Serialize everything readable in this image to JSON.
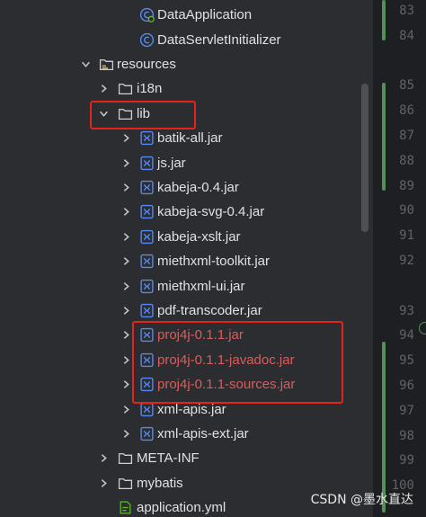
{
  "tree": {
    "items": [
      {
        "label": "DataApplication",
        "icon": "spring-class-icon",
        "chevron": "none",
        "indent": 3,
        "style": "normal"
      },
      {
        "label": "DataServletInitializer",
        "icon": "class-icon",
        "chevron": "none",
        "indent": 3,
        "style": "normal"
      },
      {
        "label": "resources",
        "icon": "resources-folder-icon",
        "chevron": "down",
        "indent": 1,
        "style": "normal"
      },
      {
        "label": "i18n",
        "icon": "folder-icon",
        "chevron": "right",
        "indent": 2,
        "style": "normal"
      },
      {
        "label": "lib",
        "icon": "folder-icon",
        "chevron": "down",
        "indent": 2,
        "style": "normal"
      },
      {
        "label": "batik-all.jar",
        "icon": "jar-icon",
        "chevron": "right",
        "indent": 3,
        "style": "normal"
      },
      {
        "label": "js.jar",
        "icon": "jar-icon",
        "chevron": "right",
        "indent": 3,
        "style": "normal"
      },
      {
        "label": "kabeja-0.4.jar",
        "icon": "jar-icon",
        "chevron": "right",
        "indent": 3,
        "style": "normal"
      },
      {
        "label": "kabeja-svg-0.4.jar",
        "icon": "jar-icon",
        "chevron": "right",
        "indent": 3,
        "style": "normal"
      },
      {
        "label": "kabeja-xslt.jar",
        "icon": "jar-icon",
        "chevron": "right",
        "indent": 3,
        "style": "normal"
      },
      {
        "label": "miethxml-toolkit.jar",
        "icon": "jar-icon",
        "chevron": "right",
        "indent": 3,
        "style": "normal"
      },
      {
        "label": "miethxml-ui.jar",
        "icon": "jar-icon",
        "chevron": "right",
        "indent": 3,
        "style": "normal"
      },
      {
        "label": "pdf-transcoder.jar",
        "icon": "jar-icon",
        "chevron": "right",
        "indent": 3,
        "style": "normal"
      },
      {
        "label": "proj4j-0.1.1.jar",
        "icon": "jar-icon",
        "chevron": "right",
        "indent": 3,
        "style": "red"
      },
      {
        "label": "proj4j-0.1.1-javadoc.jar",
        "icon": "jar-icon",
        "chevron": "right",
        "indent": 3,
        "style": "red"
      },
      {
        "label": "proj4j-0.1.1-sources.jar",
        "icon": "jar-icon",
        "chevron": "right",
        "indent": 3,
        "style": "red"
      },
      {
        "label": "xml-apis.jar",
        "icon": "jar-icon",
        "chevron": "right",
        "indent": 3,
        "style": "normal"
      },
      {
        "label": "xml-apis-ext.jar",
        "icon": "jar-icon",
        "chevron": "right",
        "indent": 3,
        "style": "normal"
      },
      {
        "label": "META-INF",
        "icon": "folder-icon",
        "chevron": "right",
        "indent": 2,
        "style": "normal"
      },
      {
        "label": "mybatis",
        "icon": "folder-icon",
        "chevron": "right",
        "indent": 2,
        "style": "normal"
      },
      {
        "label": "application.yml",
        "icon": "yaml-file-icon",
        "chevron": "none",
        "indent": 2,
        "style": "normal"
      }
    ]
  },
  "gutter": {
    "lines": [
      "83",
      "84",
      "",
      "85",
      "86",
      "87",
      "88",
      "89",
      "90",
      "91",
      "92",
      "",
      "93",
      "94",
      "95",
      "96",
      "97",
      "98",
      "99",
      "100"
    ]
  },
  "watermark": "CSDN @墨水直达",
  "colors": {
    "background": "#2b2d30",
    "gutter": "#1e1f22",
    "text": "#dfe1e5",
    "conflict_red": "#db5c5c",
    "highlight_box": "#e4241b",
    "vcs_green": "#549159",
    "jar_icon": "#548af7"
  }
}
